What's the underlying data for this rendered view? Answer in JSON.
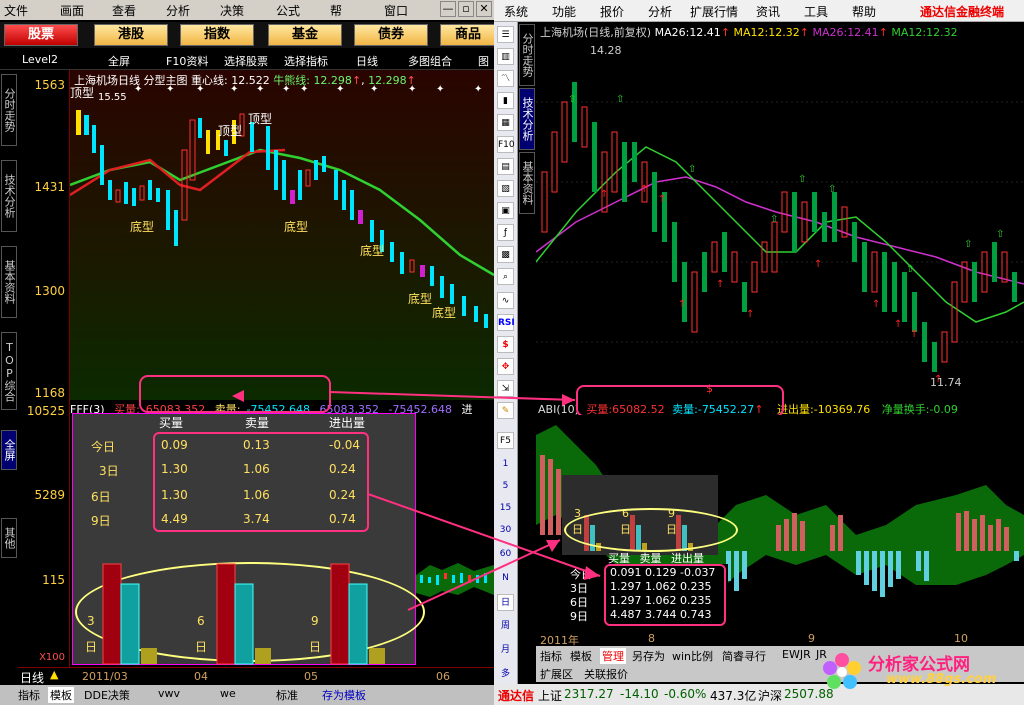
{
  "left": {
    "menu": [
      "文件",
      "画面",
      "查看",
      "分析",
      "决策",
      "公式",
      "帮",
      "窗口"
    ],
    "window_buttons": [
      "—",
      "▫",
      "✕"
    ],
    "category_tabs": [
      "股票",
      "港股",
      "指数",
      "基金",
      "债券",
      "商品"
    ],
    "toolbar": [
      "Level2",
      "全屏",
      "F10资料",
      "选择股票",
      "选择指标",
      "日线",
      "多图组合",
      "图"
    ],
    "side_tabs": [
      "分时走势",
      "技术分析",
      "基本资料",
      "TOP综合",
      "全屏",
      "其他"
    ],
    "y_labels": [
      "1563",
      "1431",
      "1300",
      "1168",
      "10525",
      "5289",
      "115"
    ],
    "x100": "X100",
    "chart_info": {
      "title": "上海机场日线",
      "indicator": "分型主图",
      "center_label": "重心线:",
      "center_value": "12.522",
      "bull_label": "牛熊线:",
      "bull_value1": "12.298",
      "bull_value2": "12.298"
    },
    "annotations": {
      "top_label": "顶型",
      "high_price": "15.55",
      "bottom_label": "底型"
    },
    "indicator_header": {
      "name": "FFF(3)",
      "buy_label": "买量:",
      "buy_value": "65083.352",
      "sell_label": "卖量:",
      "sell_value": "-75452.648",
      "extra1": "65083.352",
      "extra2": "-75452.648",
      "extra3": "进"
    },
    "popup": {
      "headers": [
        "买量",
        "卖量",
        "进出量"
      ],
      "rows": [
        {
          "label": "今日",
          "buy": "0.09",
          "sell": "0.13",
          "net": "-0.04"
        },
        {
          "label": "3日",
          "buy": "1.30",
          "sell": "1.06",
          "net": "0.24"
        },
        {
          "label": "6日",
          "buy": "1.30",
          "sell": "1.06",
          "net": "0.24"
        },
        {
          "label": "9日",
          "buy": "4.49",
          "sell": "3.74",
          "net": "0.74"
        }
      ],
      "bar_groups": [
        {
          "num": "3",
          "unit": "日"
        },
        {
          "num": "6",
          "unit": "日"
        },
        {
          "num": "9",
          "unit": "日"
        }
      ]
    },
    "time_axis": [
      "日线",
      "2011/03",
      "04",
      "05",
      "06"
    ],
    "bottom_tabs": [
      "指标",
      "模板",
      "DDE决策",
      "vwv",
      "we",
      "标准",
      "存为模板"
    ]
  },
  "right": {
    "menu": [
      "系统",
      "功能",
      "报价",
      "分析",
      "扩展行情",
      "资讯",
      "工具",
      "帮助"
    ],
    "brand": "通达信金融终端",
    "side_tabs": [
      "分时走势",
      "技术分析",
      "基本资料"
    ],
    "toolbar_icons": [
      "F10",
      "F5",
      "1",
      "5",
      "15",
      "30",
      "60",
      "N",
      "日",
      "周",
      "月",
      "多",
      "RSI",
      "$"
    ],
    "chart_info": {
      "title": "上海机场(日线,前复权)",
      "ma26_label": "MA26:",
      "ma26_value": "12.41",
      "ma12_label": "MA12:",
      "ma12_value": "12.32",
      "ma26b_label": "MA26:",
      "ma26b_value": "12.41",
      "ma12b_label": "MA12:",
      "ma12b_value": "12.32"
    },
    "annotations": {
      "high": "14.28",
      "low": "11.74"
    },
    "indicator_header": {
      "name": "ABI(10)",
      "buy_label": "买量:",
      "buy_value": "65082.52",
      "sell_label": "卖量:",
      "sell_value": "-75452.27",
      "net_label": "进出量:",
      "net_value": "-10369.76",
      "turnover_label": "净量换手:",
      "turnover_value": "-0.09"
    },
    "bar_groups": [
      {
        "num": "3",
        "unit": "日"
      },
      {
        "num": "6",
        "unit": "日"
      },
      {
        "num": "9",
        "unit": "日"
      }
    ],
    "popup_headers": [
      "买量",
      "卖量",
      "进出量"
    ],
    "popup_rows": [
      {
        "label": "今日",
        "vals": "0.091 0.129 -0.037"
      },
      {
        "label": "3日",
        "vals": "1.297 1.062 0.235"
      },
      {
        "label": "6日",
        "vals": "1.297 1.062 0.235"
      },
      {
        "label": "9日",
        "vals": "4.487 3.744 0.743"
      }
    ],
    "time_axis": [
      "2011年",
      "8",
      "9",
      "10"
    ],
    "bottom_tabs": [
      "指标",
      "模板",
      "管理",
      "另存为",
      "win比例",
      "简睿寻行",
      "EWJR",
      "JR"
    ],
    "bottom_tabs2": [
      "扩展区",
      "关联报价"
    ],
    "status": {
      "brand": "通达信",
      "index_label": "上证",
      "index_value": "2317.27",
      "change": "-14.10",
      "pct": "-0.60%",
      "amount": "437.3亿",
      "sz_label": "沪深",
      "sz_value": "2507.88"
    }
  },
  "watermark": {
    "title": "分析家公式网",
    "url": "www.88gs.com"
  },
  "colors": {
    "up": "#ff3030",
    "down": "#00ffff",
    "ma_green": "#30d030",
    "ma_magenta": "#d030d0",
    "highlight": "#ff00a0",
    "label_yellow": "#ffe060"
  }
}
